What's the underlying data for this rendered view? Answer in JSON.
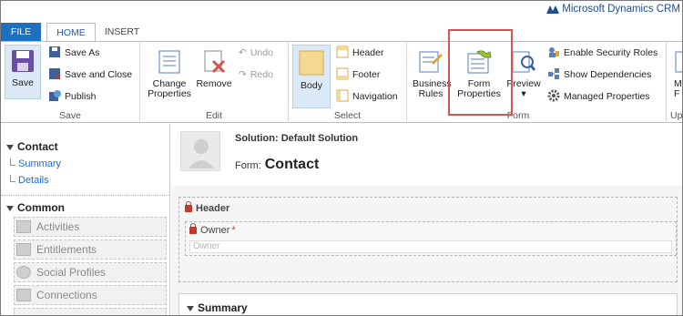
{
  "brand": {
    "name": "Microsoft Dynamics CRM"
  },
  "tabs": [
    {
      "label": "FILE"
    },
    {
      "label": "HOME"
    },
    {
      "label": "INSERT"
    }
  ],
  "ribbon": {
    "save_group": {
      "label": "Save",
      "save": "Save",
      "save_as": "Save As",
      "save_and_close": "Save and Close",
      "publish": "Publish"
    },
    "edit_group": {
      "label": "Edit",
      "change_properties_line1": "Change",
      "change_properties_line2": "Properties",
      "remove": "Remove",
      "undo": "Undo",
      "redo": "Redo"
    },
    "select_group": {
      "label": "Select",
      "body": "Body",
      "header": "Header",
      "footer": "Footer",
      "navigation": "Navigation"
    },
    "form_group": {
      "label": "Form",
      "business_rules_line1": "Business",
      "business_rules_line2": "Rules",
      "form_properties_line1": "Form",
      "form_properties_line2": "Properties",
      "preview": "Preview",
      "enable_security_roles": "Enable Security Roles",
      "show_dependencies": "Show Dependencies",
      "managed_properties": "Managed Properties"
    },
    "cut_group": {
      "label_partial": "Up",
      "btn_partial_1": "M",
      "btn_partial_2": "F"
    }
  },
  "leftnav": {
    "contact_heading": "Contact",
    "links": [
      "Summary",
      "Details"
    ],
    "common_heading": "Common",
    "items": [
      "Activities",
      "Entitlements",
      "Social Profiles",
      "Connections"
    ]
  },
  "main": {
    "solution": "Solution: Default Solution",
    "form_prefix": "Form:",
    "form_name": "Contact",
    "header_section": "Header",
    "owner_label": "Owner",
    "required_marker": "*",
    "owner_placeholder": "Owner",
    "summary_section": "Summary"
  },
  "colors": {
    "accent": "#1e6fc0",
    "highlight": "#d9534f",
    "selected_body": "#f3d991"
  }
}
